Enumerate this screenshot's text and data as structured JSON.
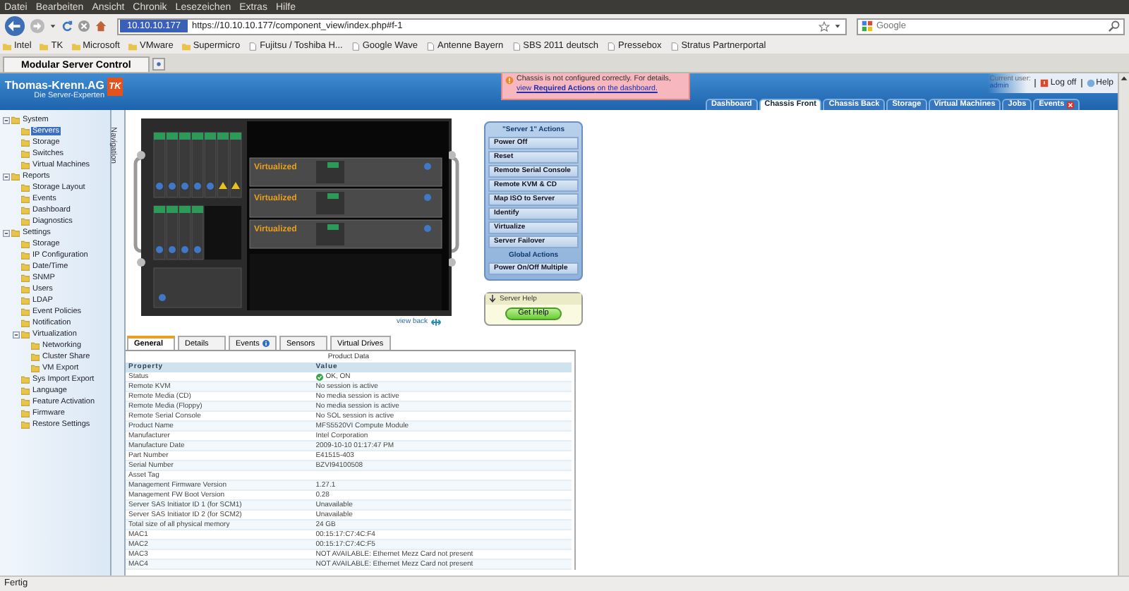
{
  "menu_bar": [
    "Datei",
    "Bearbeiten",
    "Ansicht",
    "Chronik",
    "Lesezeichen",
    "Extras",
    "Hilfe"
  ],
  "toolbar": {
    "site_identity": "10.10.10.177",
    "url": "https://10.10.10.177/component_view/index.php#f-1",
    "search_placeholder": "Google"
  },
  "bookmarks": [
    {
      "label": "Intel",
      "kind": "folder"
    },
    {
      "label": "TK",
      "kind": "folder"
    },
    {
      "label": "Microsoft",
      "kind": "folder"
    },
    {
      "label": "VMware",
      "kind": "folder"
    },
    {
      "label": "Supermicro",
      "kind": "folder"
    },
    {
      "label": "Fujitsu / Toshiba H...",
      "kind": "page"
    },
    {
      "label": "Google Wave",
      "kind": "page"
    },
    {
      "label": "Antenne Bayern",
      "kind": "page"
    },
    {
      "label": "SBS 2011 deutsch",
      "kind": "page"
    },
    {
      "label": "Pressebox",
      "kind": "page"
    },
    {
      "label": "Stratus Partnerportal",
      "kind": "page"
    }
  ],
  "browser_tabs": [
    {
      "label": "Modular Server Control",
      "selected": true
    }
  ],
  "header": {
    "logo": "Thomas-Krenn.AG",
    "tagline": "Die Server-Experten",
    "badge": "TK",
    "alert_text": "Chassis is not configured correctly. For details,",
    "alert_link": "view **Required Actions** on the dashboard.",
    "user_label": "Current user:",
    "user": "admin",
    "log_off": "Log off",
    "help": "Help",
    "tabs": [
      {
        "label": "Dashboard",
        "selected": false,
        "alert": false
      },
      {
        "label": "Chassis Front",
        "selected": true,
        "alert": false
      },
      {
        "label": "Chassis Back",
        "selected": false,
        "alert": false
      },
      {
        "label": "Storage",
        "selected": false,
        "alert": false
      },
      {
        "label": "Virtual Machines",
        "selected": false,
        "alert": false
      },
      {
        "label": "Jobs",
        "selected": false,
        "alert": false
      },
      {
        "label": "Events",
        "selected": false,
        "alert": true
      }
    ]
  },
  "sidebar": {
    "navigation_label": "Navigation",
    "tree": [
      {
        "label": "System",
        "selected": false,
        "expanded": true,
        "children": [
          {
            "label": "Servers",
            "selected": true
          },
          {
            "label": "Storage",
            "selected": false
          },
          {
            "label": "Switches",
            "selected": false
          },
          {
            "label": "Virtual Machines",
            "selected": false
          }
        ]
      },
      {
        "label": "Reports",
        "selected": false,
        "expanded": true,
        "children": [
          {
            "label": "Storage Layout",
            "selected": false
          },
          {
            "label": "Events",
            "selected": false
          },
          {
            "label": "Dashboard",
            "selected": false
          },
          {
            "label": "Diagnostics",
            "selected": false
          }
        ]
      },
      {
        "label": "Settings",
        "selected": false,
        "expanded": true,
        "children": [
          {
            "label": "Storage",
            "selected": false
          },
          {
            "label": "IP Configuration",
            "selected": false
          },
          {
            "label": "Date/Time",
            "selected": false
          },
          {
            "label": "SNMP",
            "selected": false
          },
          {
            "label": "Users",
            "selected": false
          },
          {
            "label": "LDAP",
            "selected": false
          },
          {
            "label": "Event Policies",
            "selected": false
          },
          {
            "label": "Notification",
            "selected": false
          },
          {
            "label": "Virtualization",
            "selected": false,
            "expanded": true,
            "children": [
              {
                "label": "Networking",
                "selected": false
              },
              {
                "label": "Cluster Share",
                "selected": false
              },
              {
                "label": "VM Export",
                "selected": false
              }
            ]
          },
          {
            "label": "Sys Import Export",
            "selected": false
          },
          {
            "label": "Language",
            "selected": false
          },
          {
            "label": "Feature Activation",
            "selected": false
          },
          {
            "label": "Firmware",
            "selected": false
          },
          {
            "label": "Restore Settings",
            "selected": false
          }
        ]
      }
    ]
  },
  "chassis": {
    "blade_labels": [
      "Virtualized",
      "Virtualized",
      "Virtualized"
    ],
    "view_back": "view back"
  },
  "actions": {
    "title": "\"Server 1\" Actions",
    "items": [
      "Power Off",
      "Reset",
      "Remote Serial Console",
      "Remote KVM & CD",
      "Map ISO to Server",
      "Identify",
      "Virtualize",
      "Server Failover"
    ],
    "global_title": "Global Actions",
    "global_items": [
      "Power On/Off Multiple"
    ]
  },
  "help_box": {
    "title": "Server Help",
    "button": "Get Help"
  },
  "detail_tabs": [
    {
      "label": "General",
      "selected": true,
      "info": false
    },
    {
      "label": "Details",
      "selected": false,
      "info": false
    },
    {
      "label": "Events",
      "selected": false,
      "info": true
    },
    {
      "label": "Sensors",
      "selected": false,
      "info": false
    },
    {
      "label": "Virtual Drives",
      "selected": false,
      "info": false
    }
  ],
  "table": {
    "caption": "Product Data",
    "columns": [
      "Property",
      "Value"
    ],
    "rows": [
      {
        "kind": "status",
        "property": "Status",
        "value": "OK, ON"
      },
      {
        "kind": "text",
        "property": "Remote KVM",
        "value": "No session is active"
      },
      {
        "kind": "text",
        "property": "Remote Media (CD)",
        "value": "No media session is active"
      },
      {
        "kind": "text",
        "property": "Remote Media (Floppy)",
        "value": "No media session is active"
      },
      {
        "kind": "text",
        "property": "Remote Serial Console",
        "value": "No SOL session is active"
      },
      {
        "kind": "text",
        "property": "Product Name",
        "value": "MFS5520VI Compute Module"
      },
      {
        "kind": "text",
        "property": "Manufacturer",
        "value": "Intel Corporation"
      },
      {
        "kind": "text",
        "property": "Manufacture Date",
        "value": "2009-10-10 01:17:47 PM"
      },
      {
        "kind": "text",
        "property": "Part Number",
        "value": "E41515-403"
      },
      {
        "kind": "text",
        "property": "Serial Number",
        "value": "BZVI94100508"
      },
      {
        "kind": "text",
        "property": "Asset Tag"
      },
      {
        "kind": "text",
        "property": "Management Firmware Version",
        "value": "1.27.1"
      },
      {
        "kind": "text",
        "property": "Management FW Boot Version",
        "value": "0.28"
      },
      {
        "kind": "text",
        "property": "Server SAS Initiator ID 1 (for SCM1)",
        "value": "Unavailable"
      },
      {
        "kind": "text",
        "property": "Server SAS Initiator ID 2 (for SCM2)",
        "value": "Unavailable"
      },
      {
        "kind": "text",
        "property": "Total size of all physical memory",
        "value": "24 GB"
      },
      {
        "kind": "text",
        "property": "MAC1",
        "value": "00:15:17:C7:4C:F4"
      },
      {
        "kind": "text",
        "property": "MAC2",
        "value": "00:15:17:C7:4C:F5"
      },
      {
        "kind": "text",
        "property": "MAC3",
        "value": "NOT AVAILABLE: Ethernet Mezz Card not present"
      },
      {
        "kind": "text",
        "property": "MAC4",
        "value": "NOT AVAILABLE: Ethernet Mezz Card not present"
      }
    ]
  },
  "status_bar": "Fertig"
}
